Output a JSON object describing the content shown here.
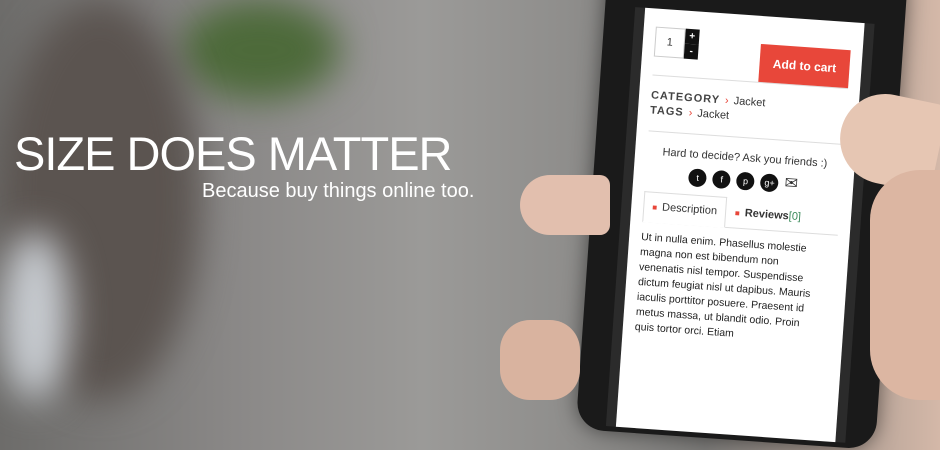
{
  "hero": {
    "title": "SIZE DOES MATTER",
    "subtitle": "Because buy things online too."
  },
  "phone": {
    "quantity": "1",
    "plus": "+",
    "minus": "-",
    "add_to_cart": "Add to cart",
    "category_label": "CATEGORY",
    "category_value": "Jacket",
    "tags_label": "TAGS",
    "tags_value": "Jacket",
    "arrow": "›",
    "share_text": "Hard to decide? Ask you friends :)",
    "share_icons": [
      "twitter-icon",
      "facebook-icon",
      "pinterest-icon",
      "google-plus-icon",
      "email-icon"
    ],
    "tabs": [
      {
        "label": "Description"
      },
      {
        "label": "Reviews",
        "count": "[0]"
      }
    ],
    "description_lines": [
      "Ut in nulla enim. Phasellus molestie",
      "magna non est bibendum non",
      "venenatis nisl tempor. Suspendisse",
      "dictum feugiat nisl ut dapibus. Mauris",
      "iaculis porttitor posuere. Praesent id",
      "metus massa, ut blandit odio. Proin",
      "quis tortor orci. Etiam"
    ],
    "accent": "#e8473a"
  }
}
